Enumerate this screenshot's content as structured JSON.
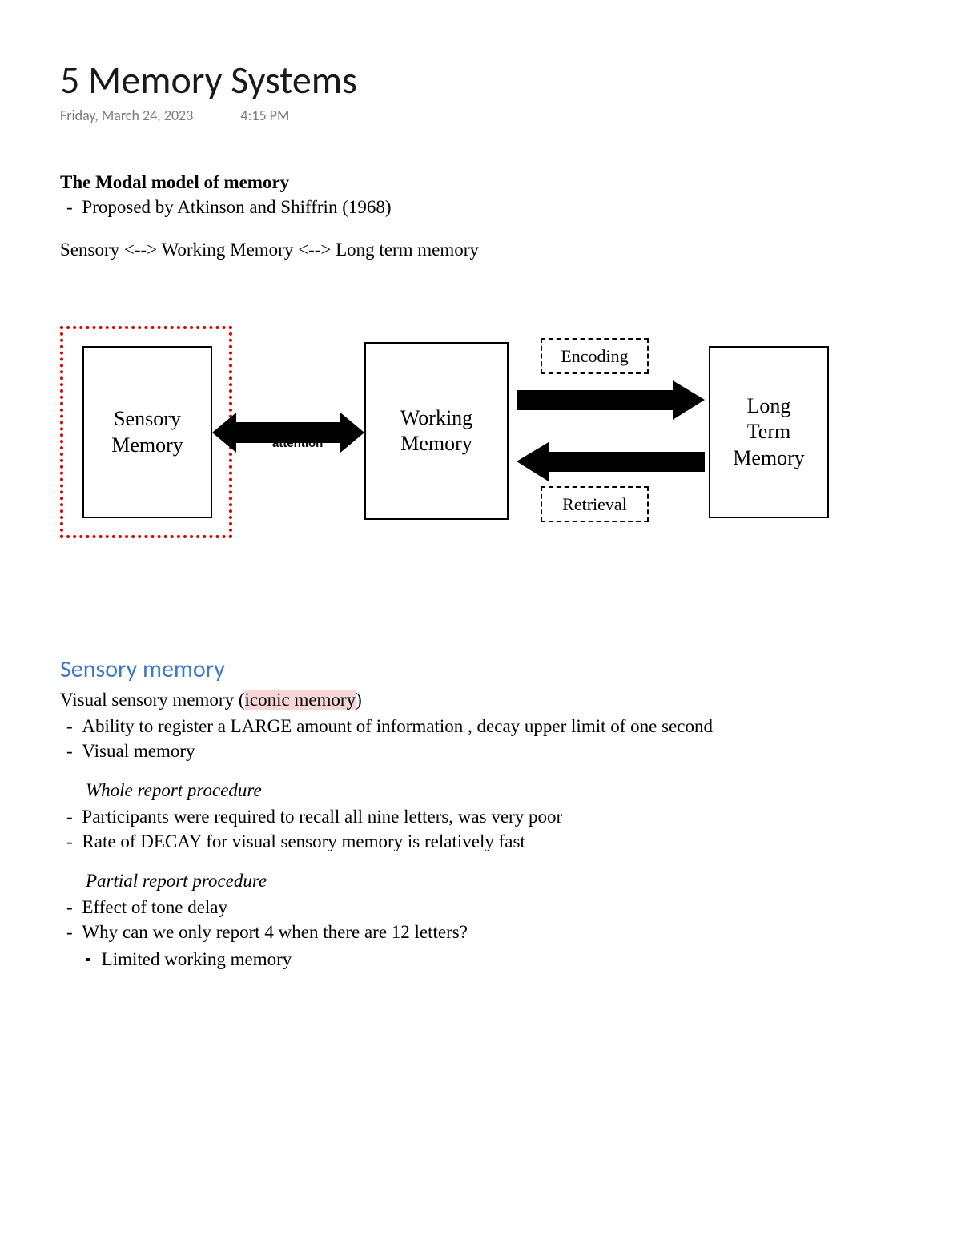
{
  "title": "5 Memory Systems",
  "date": "Friday, March 24, 2023",
  "time": "4:15 PM",
  "modal": {
    "heading": "The Modal model of memory",
    "proposed": "Proposed by Atkinson and Shiffrin (1968)"
  },
  "flow_line": "Sensory <--> Working Memory <--> Long term memory",
  "diagram": {
    "sensory": "Sensory\nMemory",
    "working": "Working\nMemory",
    "ltm": "Long\nTerm\nMemory",
    "attention": "attention",
    "encoding": "Encoding",
    "retrieval": "Retrieval"
  },
  "sensory": {
    "heading": "Sensory memory",
    "line_prefix": "Visual sensory memory (",
    "line_highlight": "iconic memory",
    "line_suffix": ")",
    "bullets": [
      "Ability to register a LARGE amount of information , decay upper limit of one second",
      "Visual memory"
    ],
    "whole_report_title": "Whole report procedure",
    "whole_report_bullets": [
      "Participants were required to recall all nine letters, was very poor",
      "Rate of DECAY for visual sensory memory is relatively fast"
    ],
    "partial_report_title": "Partial report procedure",
    "partial_report_bullets": [
      "Effect of tone delay",
      "Why can we only report 4 when there are 12 letters?"
    ],
    "partial_sub_bullet": "Limited working memory"
  }
}
